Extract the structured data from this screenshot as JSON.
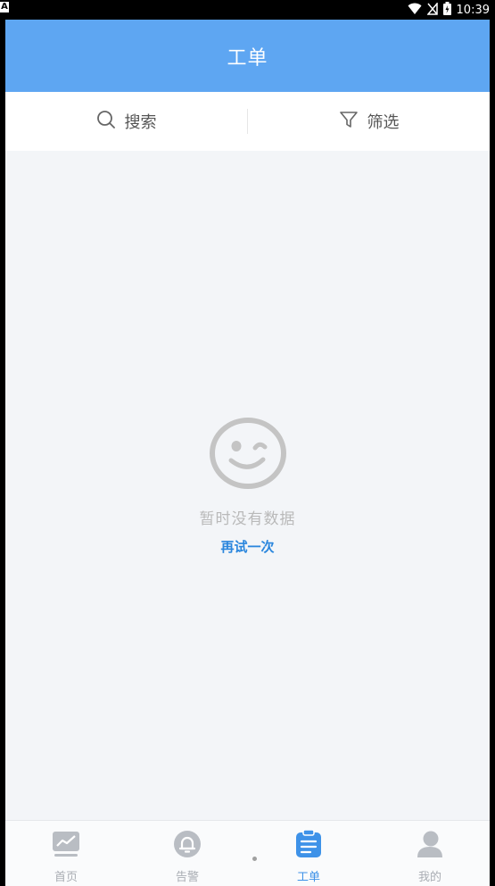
{
  "status_bar": {
    "left_indicator": "A",
    "time": "10:39"
  },
  "header": {
    "title": "工单"
  },
  "toolbar": {
    "search_label": "搜索",
    "filter_label": "筛选"
  },
  "empty_state": {
    "message": "暂时没有数据",
    "retry_label": "再试一次"
  },
  "bottom_nav": {
    "items": [
      {
        "label": "首页",
        "icon": "home-chart-icon",
        "active": false
      },
      {
        "label": "告警",
        "icon": "bell-icon",
        "active": false
      },
      {
        "label": "工单",
        "icon": "clipboard-icon",
        "active": true
      },
      {
        "label": "我的",
        "icon": "user-icon",
        "active": false
      }
    ]
  },
  "colors": {
    "header_bg": "#5ea6f2",
    "active_nav": "#3e92e8",
    "retry_link": "#2a86dd"
  }
}
